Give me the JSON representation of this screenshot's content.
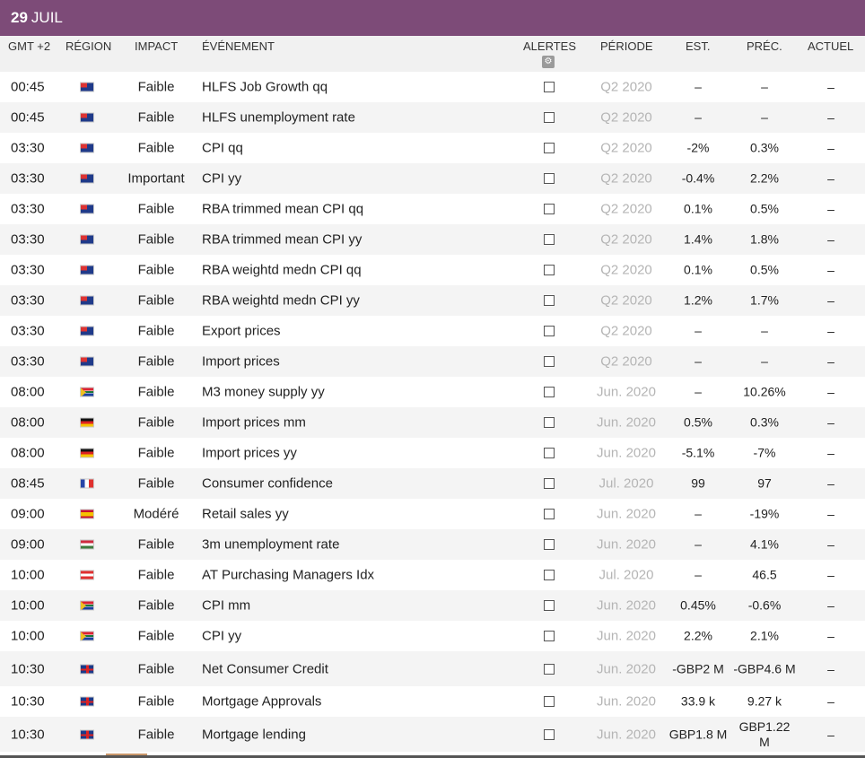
{
  "date_bar": {
    "day": "29",
    "month": "JUIL"
  },
  "columns": {
    "time": "GMT +2",
    "region": "RÉGION",
    "impact": "IMPACT",
    "event": "ÉVÉNEMENT",
    "alerts": "ALERTES",
    "period": "PÉRIODE",
    "est": "EST.",
    "prev": "PRÉC.",
    "actual": "ACTUEL"
  },
  "colors": {
    "accent": "#7d4b78",
    "header_bg": "#f1f1f1",
    "period_text": "#b5b5b5"
  },
  "rows": [
    {
      "time": "00:45",
      "flag": "au-flag",
      "impact": "Faible",
      "event": "HLFS Job Growth qq",
      "period": "Q2 2020",
      "est": "–",
      "prev": "–",
      "actual": "–"
    },
    {
      "time": "00:45",
      "flag": "au-flag",
      "impact": "Faible",
      "event": "HLFS unemployment rate",
      "period": "Q2 2020",
      "est": "–",
      "prev": "–",
      "actual": "–"
    },
    {
      "time": "03:30",
      "flag": "au-flag",
      "impact": "Faible",
      "event": "CPI qq",
      "period": "Q2 2020",
      "est": "-2%",
      "prev": "0.3%",
      "actual": "–"
    },
    {
      "time": "03:30",
      "flag": "au-flag",
      "impact": "Important",
      "event": "CPI yy",
      "period": "Q2 2020",
      "est": "-0.4%",
      "prev": "2.2%",
      "actual": "–"
    },
    {
      "time": "03:30",
      "flag": "au-flag",
      "impact": "Faible",
      "event": "RBA trimmed mean CPI qq",
      "period": "Q2 2020",
      "est": "0.1%",
      "prev": "0.5%",
      "actual": "–"
    },
    {
      "time": "03:30",
      "flag": "au-flag",
      "impact": "Faible",
      "event": "RBA trimmed mean CPI yy",
      "period": "Q2 2020",
      "est": "1.4%",
      "prev": "1.8%",
      "actual": "–"
    },
    {
      "time": "03:30",
      "flag": "au-flag",
      "impact": "Faible",
      "event": "RBA weightd medn CPI qq",
      "period": "Q2 2020",
      "est": "0.1%",
      "prev": "0.5%",
      "actual": "–"
    },
    {
      "time": "03:30",
      "flag": "au-flag",
      "impact": "Faible",
      "event": "RBA weightd medn CPI yy",
      "period": "Q2 2020",
      "est": "1.2%",
      "prev": "1.7%",
      "actual": "–"
    },
    {
      "time": "03:30",
      "flag": "au-flag",
      "impact": "Faible",
      "event": "Export prices",
      "period": "Q2 2020",
      "est": "–",
      "prev": "–",
      "actual": "–"
    },
    {
      "time": "03:30",
      "flag": "au-flag",
      "impact": "Faible",
      "event": "Import prices",
      "period": "Q2 2020",
      "est": "–",
      "prev": "–",
      "actual": "–"
    },
    {
      "time": "08:00",
      "flag": "za-flag",
      "impact": "Faible",
      "event": "M3 money supply yy",
      "period": "Jun. 2020",
      "est": "–",
      "prev": "10.26%",
      "actual": "–"
    },
    {
      "time": "08:00",
      "flag": "de-flag",
      "impact": "Faible",
      "event": "Import prices mm",
      "period": "Jun. 2020",
      "est": "0.5%",
      "prev": "0.3%",
      "actual": "–"
    },
    {
      "time": "08:00",
      "flag": "de-flag",
      "impact": "Faible",
      "event": "Import prices yy",
      "period": "Jun. 2020",
      "est": "-5.1%",
      "prev": "-7%",
      "actual": "–"
    },
    {
      "time": "08:45",
      "flag": "fr-flag",
      "impact": "Faible",
      "event": "Consumer confidence",
      "period": "Jul. 2020",
      "est": "99",
      "prev": "97",
      "actual": "–"
    },
    {
      "time": "09:00",
      "flag": "es-flag",
      "impact": "Modéré",
      "event": "Retail sales yy",
      "period": "Jun. 2020",
      "est": "–",
      "prev": "-19%",
      "actual": "–"
    },
    {
      "time": "09:00",
      "flag": "hu-flag",
      "impact": "Faible",
      "event": "3m unemployment rate",
      "period": "Jun. 2020",
      "est": "–",
      "prev": "4.1%",
      "actual": "–"
    },
    {
      "time": "10:00",
      "flag": "at-flag",
      "impact": "Faible",
      "event": "AT Purchasing Managers Idx",
      "period": "Jul. 2020",
      "est": "–",
      "prev": "46.5",
      "actual": "–"
    },
    {
      "time": "10:00",
      "flag": "za-flag",
      "impact": "Faible",
      "event": "CPI mm",
      "period": "Jun. 2020",
      "est": "0.45%",
      "prev": "-0.6%",
      "actual": "–"
    },
    {
      "time": "10:00",
      "flag": "za-flag",
      "impact": "Faible",
      "event": "CPI yy",
      "period": "Jun. 2020",
      "est": "2.2%",
      "prev": "2.1%",
      "actual": "–"
    },
    {
      "time": "10:30",
      "flag": "gb-flag",
      "impact": "Faible",
      "event": "Net Consumer Credit",
      "period": "Jun. 2020",
      "est": "-GBP2 M",
      "prev": "-GBP4.6 M",
      "actual": "–"
    },
    {
      "time": "10:30",
      "flag": "gb-flag",
      "impact": "Faible",
      "event": "Mortgage Approvals",
      "period": "Jun. 2020",
      "est": "33.9 k",
      "prev": "9.27 k",
      "actual": "–"
    },
    {
      "time": "10:30",
      "flag": "gb-flag",
      "impact": "Faible",
      "event": "Mortgage lending",
      "period": "Jun. 2020",
      "est": "GBP1.8 M",
      "prev": "GBP1.22 M",
      "actual": "–"
    }
  ]
}
